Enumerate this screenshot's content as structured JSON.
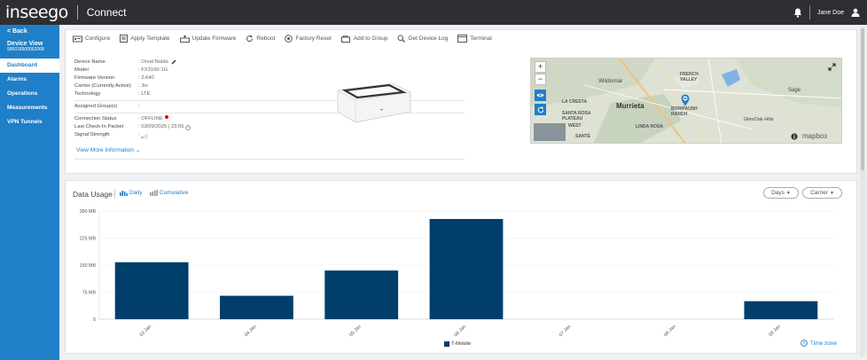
{
  "header": {
    "logo": "inseego",
    "product": "Connect",
    "user": "Jane Doe"
  },
  "sidebar": {
    "back": "< Back",
    "device_view_title": "Device View",
    "device_id": "990018900062068",
    "items": [
      {
        "label": "Dashboard",
        "active": true
      },
      {
        "label": "Alarms",
        "active": false
      },
      {
        "label": "Operations",
        "active": false
      },
      {
        "label": "Measurements",
        "active": false
      },
      {
        "label": "VPN Tunnels",
        "active": false
      }
    ]
  },
  "toolbar": {
    "items": [
      {
        "label": "Configure",
        "icon": "configure-icon"
      },
      {
        "label": "Apply Template",
        "icon": "template-icon"
      },
      {
        "label": "Update Firmware",
        "icon": "firmware-icon"
      },
      {
        "label": "Reboot",
        "icon": "reboot-icon"
      },
      {
        "label": "Factory Reset",
        "icon": "factory-reset-icon"
      },
      {
        "label": "Add to Group",
        "icon": "add-group-icon"
      },
      {
        "label": "Get Device Log",
        "icon": "device-log-icon"
      },
      {
        "label": "Terminal",
        "icon": "terminal-icon"
      }
    ]
  },
  "device": {
    "name_label": "Device Name",
    "name_value": ": Orval Noida",
    "model_label": "Model",
    "model_value": ": FX3100-1G",
    "firmware_label": "Firmware Version",
    "firmware_value": ": 2.640",
    "carrier_label": "Carrier (Currently Active)",
    "carrier_value": ": Jio",
    "tech_label": "Technology",
    "tech_value": ": LTE",
    "groups_label": "Assigned Group(s)",
    "groups_value": ":",
    "status_label": "Connection Status",
    "status_value": ": OFFLINE",
    "checkin_label": "Last Check-In Packet",
    "checkin_value": ": 03/09/2025 | 23:05",
    "signal_label": "Signal Strength",
    "signal_value": ":",
    "more_link": "View More Information"
  },
  "map": {
    "labels": [
      "Wildomar",
      "Murrieta",
      "FRENCH VALLEY",
      "Sage",
      "LA CRESTA",
      "SANTA ROSA PLATEAU",
      "LINDA ROSA",
      "GlenOak Hills",
      "WEST",
      "SANTE",
      "BORIPAUSH RANCH"
    ],
    "attribution": "mapbox"
  },
  "usage": {
    "title": "Data Usage",
    "tab_daily": "Daily",
    "tab_cumulative": "Cumulative",
    "days_button": "Days",
    "carrier_button": "Carrier",
    "timezone": "Time zone"
  },
  "chart_data": {
    "type": "bar",
    "categories": [
      "03 Jan",
      "04 Jan",
      "05 Jan",
      "06 Jan",
      "07 Jan",
      "08 Jan",
      "09 Jan"
    ],
    "series": [
      {
        "name": "T-Mobile",
        "color": "#003f6b",
        "values": [
          158,
          65,
          135,
          278,
          0,
          0,
          50
        ]
      }
    ],
    "yticks": [
      "0",
      "75 MB",
      "150 MB",
      "225 MB",
      "300 MB"
    ],
    "ylim": [
      0,
      300
    ],
    "xlabel": "",
    "ylabel": ""
  }
}
